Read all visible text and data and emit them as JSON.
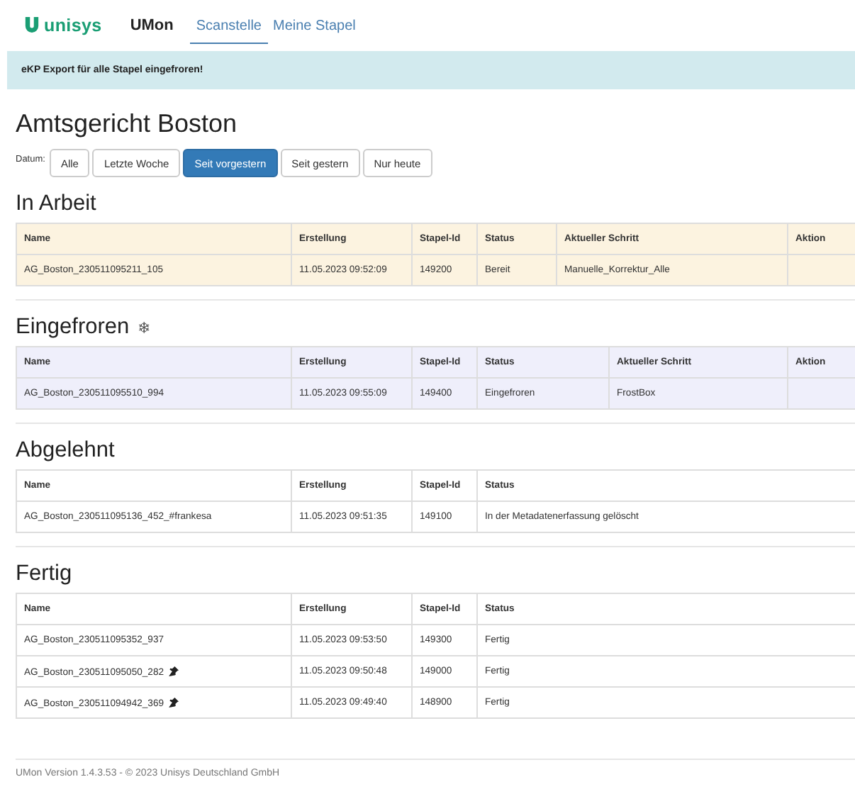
{
  "navbar": {
    "brand": "unisys",
    "app_name": "UMon",
    "tabs": [
      {
        "label": "Scanstelle",
        "selected": true
      },
      {
        "label": "Meine Stapel",
        "selected": false
      }
    ]
  },
  "alert": "eKP Export für alle Stapel eingefroren!",
  "page_title": "Amtsgericht Boston",
  "date_filter": {
    "label": "Datum:",
    "options": [
      {
        "label": "Alle",
        "selected": false
      },
      {
        "label": "Letzte Woche",
        "selected": false
      },
      {
        "label": "Seit vorgestern",
        "selected": true
      },
      {
        "label": "Seit gestern",
        "selected": false
      },
      {
        "label": "Nur heute",
        "selected": false
      }
    ]
  },
  "sections": [
    {
      "title": "In Arbeit",
      "kind": "working",
      "columns": [
        "Name",
        "Erstellung",
        "Stapel-Id",
        "Status",
        "Aktueller Schritt",
        "Aktion"
      ],
      "rows": [
        {
          "cells": [
            "AG_Boston_230511095211_105",
            "11.05.2023 09:52:09",
            "149200",
            "Bereit",
            "Manuelle_Korrektur_Alle",
            ""
          ],
          "pinned": false
        }
      ]
    },
    {
      "title": "Eingefroren",
      "title_icon": "❄",
      "kind": "frozen",
      "columns": [
        "Name",
        "Erstellung",
        "Stapel-Id",
        "Status",
        "Aktueller Schritt",
        "Aktion"
      ],
      "rows": [
        {
          "cells": [
            "AG_Boston_230511095510_994",
            "11.05.2023 09:55:09",
            "149400",
            "Eingefroren",
            "FrostBox",
            ""
          ],
          "pinned": false
        }
      ]
    },
    {
      "title": "Abgelehnt",
      "kind": "plain",
      "columns": [
        "Name",
        "Erstellung",
        "Stapel-Id",
        "Status"
      ],
      "rows": [
        {
          "cells": [
            "AG_Boston_230511095136_452_#frankesa",
            "11.05.2023 09:51:35",
            "149100",
            "In der Metadatenerfassung gelöscht"
          ],
          "pinned": false
        }
      ]
    },
    {
      "title": "Fertig",
      "kind": "plain",
      "columns": [
        "Name",
        "Erstellung",
        "Stapel-Id",
        "Status"
      ],
      "rows": [
        {
          "cells": [
            "AG_Boston_230511095352_937",
            "11.05.2023 09:53:50",
            "149300",
            "Fertig"
          ],
          "pinned": false
        },
        {
          "cells": [
            "AG_Boston_230511095050_282",
            "11.05.2023 09:50:48",
            "149000",
            "Fertig"
          ],
          "pinned": true
        },
        {
          "cells": [
            "AG_Boston_230511094942_369",
            "11.05.2023 09:49:40",
            "148900",
            "Fertig"
          ],
          "pinned": true
        }
      ]
    }
  ],
  "footer": "UMon Version 1.4.3.53  -  © 2023 Unisys Deutschland GmbH"
}
